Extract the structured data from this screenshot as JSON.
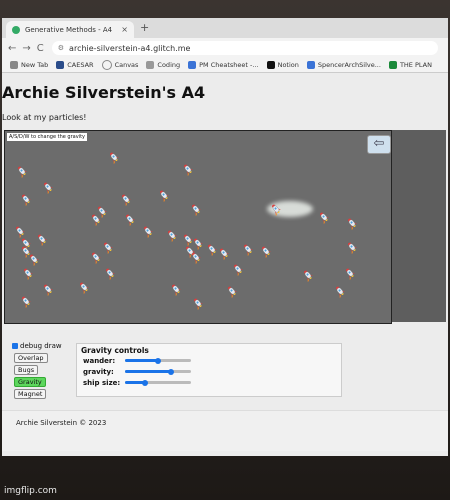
{
  "browser": {
    "tab_title": "Generative Methods - A4",
    "tab_close": "×",
    "new_tab": "+",
    "url": "archie-silverstein-a4.glitch.me",
    "nav": {
      "back": "←",
      "forward": "→",
      "reload": "C"
    },
    "bookmarks": [
      "New Tab",
      "CAESAR",
      "Canvas",
      "Coding",
      "PM Cheatsheet -...",
      "Notion",
      "SpencerArchSilve...",
      "THE PLAN"
    ]
  },
  "page": {
    "title": "Archie Silverstein's A4",
    "subtitle": "Look at my particles!",
    "canvas_hint": "A/S/D/W to change the gravity",
    "back_arrow": "⇦"
  },
  "controls": {
    "debug_label": "debug draw",
    "debug_checked": true,
    "modes": [
      "Overlap",
      "Bugs",
      "Gravity",
      "Magnet"
    ],
    "active_mode": "Gravity",
    "panel_title": "Gravity controls",
    "sliders": [
      {
        "label": "wander:",
        "value": 0.5
      },
      {
        "label": "gravity:",
        "value": 0.7
      },
      {
        "label": "ship size:",
        "value": 0.3
      }
    ]
  },
  "footer": {
    "text": "Archie Silverstein © 2023"
  },
  "watermark": "imgflip.com",
  "colors": {
    "active_button": "#5cd65c",
    "slider": "#1a73e8",
    "canvas_bg": "#6c6c6c"
  }
}
